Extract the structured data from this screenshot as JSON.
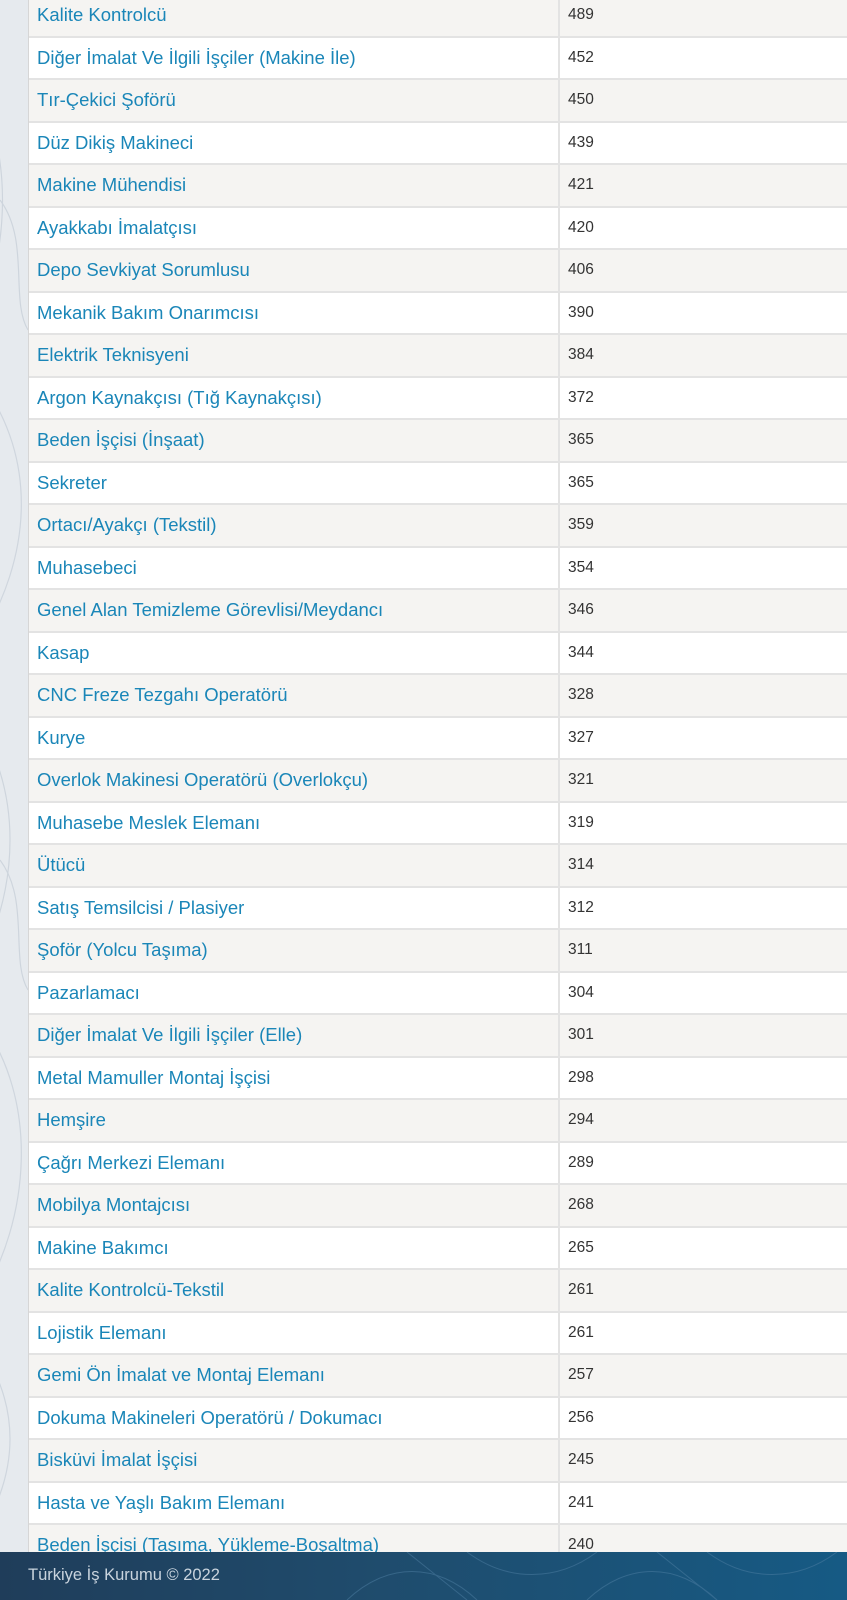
{
  "table": {
    "rows": [
      {
        "name": "Kalite Kontrolcü",
        "value": "489"
      },
      {
        "name": "Diğer İmalat Ve İlgili İşçiler (Makine İle)",
        "value": "452"
      },
      {
        "name": "Tır-Çekici Şoförü",
        "value": "450"
      },
      {
        "name": "Düz Dikiş Makineci",
        "value": "439"
      },
      {
        "name": "Makine Mühendisi",
        "value": "421"
      },
      {
        "name": "Ayakkabı İmalatçısı",
        "value": "420"
      },
      {
        "name": "Depo Sevkiyat Sorumlusu",
        "value": "406"
      },
      {
        "name": "Mekanik Bakım Onarımcısı",
        "value": "390"
      },
      {
        "name": "Elektrik Teknisyeni",
        "value": "384"
      },
      {
        "name": "Argon Kaynakçısı (Tığ Kaynakçısı)",
        "value": "372"
      },
      {
        "name": "Beden İşçisi (İnşaat)",
        "value": "365"
      },
      {
        "name": "Sekreter",
        "value": "365"
      },
      {
        "name": "Ortacı/Ayakçı (Tekstil)",
        "value": "359"
      },
      {
        "name": "Muhasebeci",
        "value": "354"
      },
      {
        "name": "Genel Alan Temizleme Görevlisi/Meydancı",
        "value": "346"
      },
      {
        "name": "Kasap",
        "value": "344"
      },
      {
        "name": "CNC Freze Tezgahı Operatörü",
        "value": "328"
      },
      {
        "name": "Kurye",
        "value": "327"
      },
      {
        "name": "Overlok Makinesi Operatörü (Overlokçu)",
        "value": "321"
      },
      {
        "name": "Muhasebe Meslek Elemanı",
        "value": "319"
      },
      {
        "name": "Ütücü",
        "value": "314"
      },
      {
        "name": "Satış Temsilcisi / Plasiyer",
        "value": "312"
      },
      {
        "name": "Şoför (Yolcu Taşıma)",
        "value": "311"
      },
      {
        "name": "Pazarlamacı",
        "value": "304"
      },
      {
        "name": "Diğer İmalat Ve İlgili İşçiler (Elle)",
        "value": "301"
      },
      {
        "name": "Metal Mamuller Montaj İşçisi",
        "value": "298"
      },
      {
        "name": "Hemşire",
        "value": "294"
      },
      {
        "name": "Çağrı Merkezi Elemanı",
        "value": "289"
      },
      {
        "name": "Mobilya Montajcısı",
        "value": "268"
      },
      {
        "name": "Makine Bakımcı",
        "value": "265"
      },
      {
        "name": "Kalite Kontrolcü-Tekstil",
        "value": "261"
      },
      {
        "name": "Lojistik Elemanı",
        "value": "261"
      },
      {
        "name": "Gemi Ön İmalat ve Montaj Elemanı",
        "value": "257"
      },
      {
        "name": "Dokuma Makineleri Operatörü / Dokumacı",
        "value": "256"
      },
      {
        "name": "Bisküvi İmalat İşçisi",
        "value": "245"
      },
      {
        "name": "Hasta ve Yaşlı Bakım Elemanı",
        "value": "241"
      },
      {
        "name": "Beden İşçisi (Taşıma, Yükleme-Boşaltma)",
        "value": "240"
      }
    ]
  },
  "footer": {
    "copyright": "Türkiye İş Kurumu © 2022"
  },
  "colors": {
    "link": "#1a86b8",
    "value_text": "#333333",
    "footer_bg": "#1f4c6d"
  }
}
